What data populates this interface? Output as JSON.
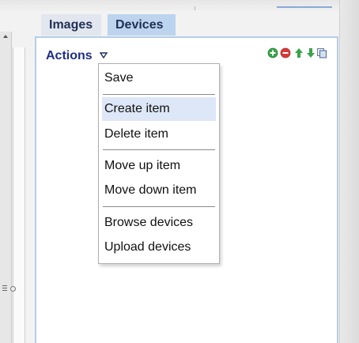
{
  "tabs": [
    {
      "label": "Images",
      "active": false
    },
    {
      "label": "Devices",
      "active": true
    }
  ],
  "panel": {
    "actions_label": "Actions",
    "caret_icon": "triangle-down-outline-icon",
    "toolbar_icons": [
      "add-circle-icon",
      "remove-circle-icon",
      "arrow-up-icon",
      "arrow-down-icon",
      "copy-icon"
    ]
  },
  "menu": {
    "items": [
      {
        "label": "Save"
      },
      {
        "label": "Create item",
        "highlighted": true
      },
      {
        "label": "Delete item"
      },
      {
        "label": "Move up item"
      },
      {
        "label": "Move down item"
      },
      {
        "label": "Browse devices"
      },
      {
        "label": "Upload devices"
      }
    ]
  },
  "colors": {
    "tab_active": "#bcd4ee",
    "tab_inactive": "#e2e6ee",
    "panel_border": "#b6cde8",
    "accent_text": "#1f2f8a",
    "menu_highlight": "#dde7f7",
    "add_green": "#3aa34a",
    "remove_red": "#d83a3a"
  }
}
